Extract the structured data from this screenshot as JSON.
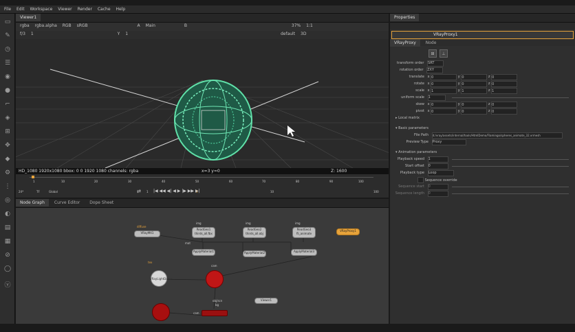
{
  "menu": [
    "File",
    "Edit",
    "Workspace",
    "Viewer",
    "Render",
    "Cache",
    "Help"
  ],
  "toolbar_icons": [
    "viewer-icon",
    "pen-icon",
    "clock-icon",
    "layers-icon",
    "paint-icon",
    "circle-icon",
    "crop-icon",
    "filter-icon",
    "grid-icon",
    "move-icon",
    "cube-icon",
    "gear-icon",
    "dots-icon",
    "info-icon",
    "eye-icon",
    "layer-icon",
    "stack-icon",
    "link-icon",
    "sphere-icon",
    "logo-icon"
  ],
  "viewer": {
    "tab_label": "Viewer1",
    "channels": "rgba",
    "alpha": "rgba.alpha",
    "colorspace_in": "RGB",
    "colorspace_out": "sRGB",
    "view_a": "A",
    "view_mode": "Main",
    "view_b": "B",
    "zoom": "37%",
    "ratio": "1:1",
    "frame_field": "f/3",
    "frame_value": "1",
    "y_label": "Y",
    "y_value": "1",
    "lut": "default",
    "mode3d": "3D",
    "status_left": "HD_1080 1920x1080  bbox: 0 0 1920 1080 channels: rgba",
    "status_mid": "x=3 y=0",
    "status_right": "Z: 1600",
    "fps_label": "24*",
    "tf_label": "TF",
    "global_label": "Global",
    "frame_start": "1",
    "frame_end": "100",
    "frame_current": "1",
    "step": "10",
    "ticks": [
      "1",
      "10",
      "20",
      "30",
      "40",
      "50",
      "60",
      "70",
      "80",
      "90",
      "100"
    ]
  },
  "node_tabs": [
    "Node Graph",
    "Curve Editor",
    "Dope Sheet"
  ],
  "nodes": {
    "read1": "ReadGeo1\nthirds_all.fbx",
    "read2": "ReadGeo2\nthirds_all.obj",
    "read3": "ReadGeo3\nfli_animate",
    "vray_mtl": "VRayMtl1",
    "vray_proxy": "VRayProxy1",
    "apply1": "ApplyMaterial1",
    "apply2": "ApplyMaterial2",
    "apply3": "ApplyMaterial3",
    "light": "VRayLightDome",
    "viewer_node": "Viewer1",
    "img1": "img",
    "img2": "img",
    "img3": "img",
    "diffuse": "diffuse",
    "mat": "mat",
    "tex": "tex",
    "cam": "cam",
    "obj_cam": "obj/scn",
    "bg": "bg",
    "cam2": "cam"
  },
  "properties": {
    "panel_title": "Properties",
    "node_name": "VRayProxy1",
    "tabs": [
      "VRayProxy",
      "Node"
    ],
    "transform_order_label": "transform order",
    "transform_order_value": "SRT",
    "rotation_order_label": "rotation order",
    "rotation_order_value": "ZXY",
    "translate_label": "translate",
    "rotate_label": "rotate",
    "scale_label": "scale",
    "uniform_scale_label": "uniform scale",
    "skew_label": "skew",
    "pivot_label": "pivot",
    "x_label": "x",
    "y_label": "y",
    "z_label": "z",
    "translate": [
      "0",
      "0",
      "0"
    ],
    "rotate": [
      "0",
      "0",
      "0"
    ],
    "scale": [
      "1",
      "1",
      "1"
    ],
    "uniform_scale": "1",
    "skew": [
      "0",
      "0",
      "0"
    ],
    "pivot": [
      "0",
      "0",
      "0"
    ],
    "local_matrix": "Local matrix",
    "basic_params": "Basic parameters",
    "file_path_label": "File Path",
    "file_path_value": "d:/vray/assets/internal/tools/HtmlDemo/Flamingo/spheres_animate_32.vrmesh",
    "preview_type_label": "Preview Type",
    "preview_type_value": "Proxy",
    "anim_params": "Animation parameters",
    "playback_speed_label": "Playback speed",
    "playback_speed_value": "1",
    "start_offset_label": "Start offset",
    "start_offset_value": "0",
    "playback_type_label": "Playback type",
    "playback_type_value": "Loop",
    "sequence_override": "Sequence override",
    "sequence_start_label": "Sequence start",
    "sequence_start_value": "0",
    "sequence_length_label": "Sequence length",
    "sequence_length_value": "0"
  }
}
